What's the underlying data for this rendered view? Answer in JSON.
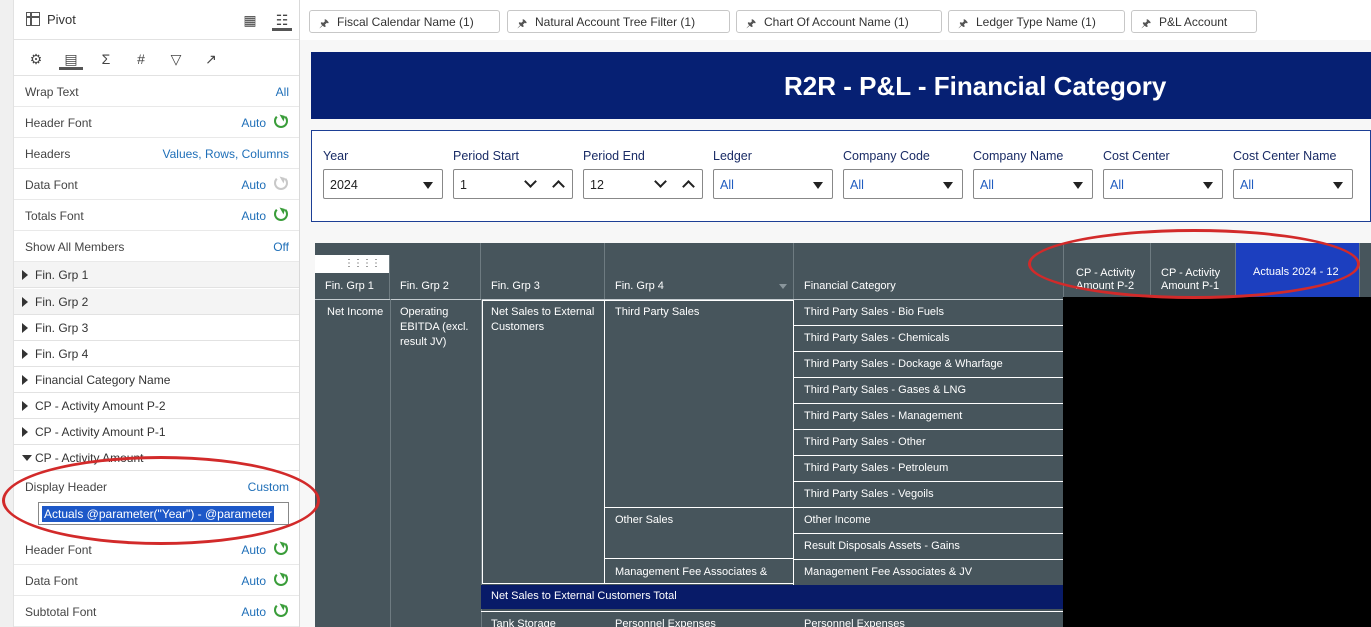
{
  "panel": {
    "title": "Pivot",
    "header_buttons": [
      "layout-icon",
      "sliders-icon"
    ],
    "tabs": [
      "gear-icon",
      "table-icon",
      "sigma-icon",
      "hash-icon",
      "filter-icon",
      "trend-icon"
    ],
    "properties": [
      {
        "label": "Wrap Text",
        "value": "All"
      },
      {
        "label": "Header Font",
        "value": "Auto"
      },
      {
        "label": "Headers",
        "value": "Values, Rows, Columns"
      },
      {
        "label": "Data Font",
        "value": "Auto"
      },
      {
        "label": "Totals Font",
        "value": "Auto"
      },
      {
        "label": "Show All Members",
        "value": "Off"
      }
    ],
    "sections": [
      "Fin. Grp 1",
      "Fin. Grp 2",
      "Fin. Grp 3",
      "Fin. Grp 4",
      "Financial Category Name",
      "CP - Activity Amount P-2",
      "CP - Activity Amount P-1",
      "CP - Activity Amount"
    ],
    "display_header": {
      "label": "Display Header",
      "value": "Custom",
      "input": "Actuals @parameter(\"Year\") - @parameter"
    },
    "sub_properties": [
      {
        "label": "Header Font",
        "value": "Auto"
      },
      {
        "label": "Data Font",
        "value": "Auto"
      },
      {
        "label": "Subtotal Font",
        "value": "Auto"
      }
    ]
  },
  "filters": [
    "Fiscal Calendar Name (1)",
    "Natural Account Tree Filter (1)",
    "Chart Of Account Name (1)",
    "Ledger Type Name (1)",
    "P&L Account"
  ],
  "banner": {
    "title": "R2R - P&L - Financial Category"
  },
  "prompts": [
    {
      "label": "Year",
      "value": "2024",
      "kind": "select"
    },
    {
      "label": "Period Start",
      "value": "1",
      "kind": "stepper"
    },
    {
      "label": "Period End",
      "value": "12",
      "kind": "stepper"
    },
    {
      "label": "Ledger",
      "value": "All",
      "kind": "select"
    },
    {
      "label": "Company Code",
      "value": "All",
      "kind": "select"
    },
    {
      "label": "Company Name",
      "value": "All",
      "kind": "select"
    },
    {
      "label": "Cost Center",
      "value": "All",
      "kind": "select"
    },
    {
      "label": "Cost Center Name",
      "value": "All",
      "kind": "select"
    }
  ],
  "pivot": {
    "headers": {
      "grp1": "Fin. Grp 1",
      "grp2": "Fin. Grp 2",
      "grp3": "Fin. Grp 3",
      "grp4": "Fin. Grp 4",
      "category": "Financial Category",
      "p2": "CP - Activity Amount P-2",
      "p1": "CP - Activity Amount P-1",
      "actuals": "Actuals 2024 - 12"
    },
    "grp1": "Net Income",
    "grp2": "Operating EBITDA (excl. result JV)",
    "grp3": "Net Sales to External Customers",
    "grp4_third": "Third Party Sales",
    "grp4_other": "Other Sales",
    "grp4_mgmt": "Management Fee Associates &",
    "categories": [
      "Third Party Sales - Bio Fuels",
      "Third Party Sales - Chemicals",
      "Third Party Sales - Dockage & Wharfage",
      "Third Party Sales - Gases & LNG",
      "Third Party Sales - Management",
      "Third Party Sales - Other",
      "Third Party Sales - Petroleum",
      "Third Party Sales - Vegoils",
      "Other Income",
      "Result Disposals Assets - Gains",
      "Management Fee Associates & JV"
    ],
    "total": "Net Sales to External Customers Total",
    "next_grp3": "Tank Storage",
    "next_grp4": "Personnel Expenses",
    "next_category": "Personnel Expenses"
  }
}
